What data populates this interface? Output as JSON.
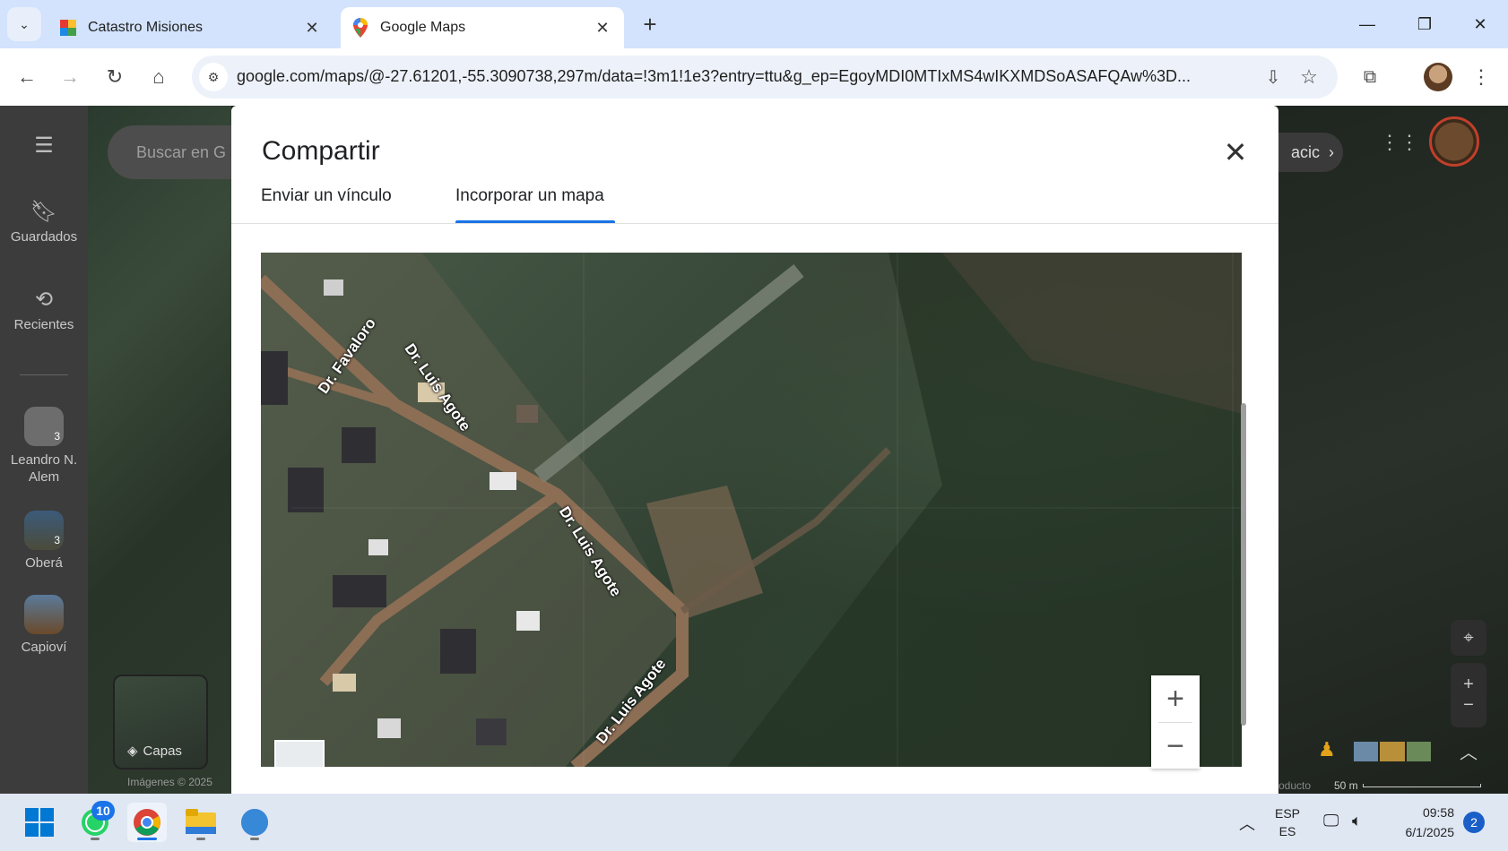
{
  "browser": {
    "tabs": [
      {
        "title": "Catastro Misiones",
        "favicon": "catastro-favicon"
      },
      {
        "title": "Google Maps",
        "favicon": "maps-pin-favicon",
        "active": true
      }
    ],
    "url": "google.com/maps/@-27.61201,-55.3090738,297m/data=!3m1!1e3?entry=ttu&g_ep=EgoyMDI0MTIxMS4wIKXMDSoASAFQAw%3D..."
  },
  "maps": {
    "search_placeholder": "Buscar en G",
    "rail": {
      "saved": "Guardados",
      "recent": "Recientes",
      "places": [
        {
          "label": "Leandro N. Alem",
          "badge": "3"
        },
        {
          "label": "Oberá",
          "badge": "3"
        },
        {
          "label": "Capioví"
        }
      ]
    },
    "layers_label": "Capas",
    "imagery_credit": "Imágenes © 2025",
    "right_chip_text": "acic",
    "footer_fragment": "oducto",
    "scale_label": "50 m"
  },
  "dialog": {
    "title": "Compartir",
    "tabs": [
      "Enviar un vínculo",
      "Incorporar un mapa"
    ],
    "active_tab": 1,
    "embed_map": {
      "road_labels": [
        "Dr. Favaloro",
        "Dr. Luis Agote",
        "Dr. Luis Agote",
        "Dr. Luis Agote"
      ],
      "zoom_in": "+",
      "zoom_out": "−"
    }
  },
  "taskbar": {
    "whatsapp_badge": "10",
    "lang_top": "ESP",
    "lang_bottom": "ES",
    "time": "09:58",
    "date": "6/1/2025",
    "notifications": "2"
  },
  "colors": {
    "accent": "#1a73e8",
    "tabbar": "#d3e3fd",
    "taskbar": "#dfe7f3"
  }
}
